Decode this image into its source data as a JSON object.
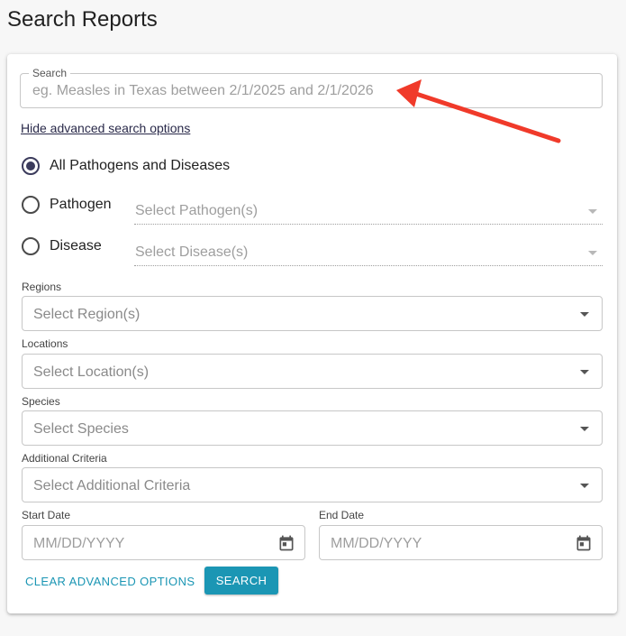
{
  "page": {
    "title": "Search Reports"
  },
  "search": {
    "legend": "Search",
    "value": "",
    "placeholder": "eg. Measles in Texas between 2/1/2025 and 2/1/2026"
  },
  "advanced": {
    "hide_link": "Hide advanced search options",
    "radios": [
      {
        "label": "All Pathogens and Diseases",
        "checked": true
      },
      {
        "label": "Pathogen",
        "checked": false,
        "select_placeholder": "Select Pathogen(s)"
      },
      {
        "label": "Disease",
        "checked": false,
        "select_placeholder": "Select Disease(s)"
      }
    ],
    "regions": {
      "label": "Regions",
      "placeholder": "Select Region(s)"
    },
    "locations": {
      "label": "Locations",
      "placeholder": "Select Location(s)"
    },
    "species": {
      "label": "Species",
      "placeholder": "Select Species"
    },
    "additional": {
      "label": "Additional Criteria",
      "placeholder": "Select Additional Criteria"
    },
    "start_date": {
      "label": "Start Date",
      "placeholder": "MM/DD/YYYY",
      "value": ""
    },
    "end_date": {
      "label": "End Date",
      "placeholder": "MM/DD/YYYY",
      "value": ""
    },
    "clear_button": "CLEAR ADVANCED OPTIONS",
    "search_button": "SEARCH"
  },
  "icons": {
    "calendar": "calendar-icon",
    "dropdown": "chevron-down-icon",
    "annotation": "arrow-annotation-icon"
  },
  "colors": {
    "accent": "#1b96b4",
    "radio_checked": "#3b3b5c",
    "annotation_arrow": "#f03a2a"
  }
}
